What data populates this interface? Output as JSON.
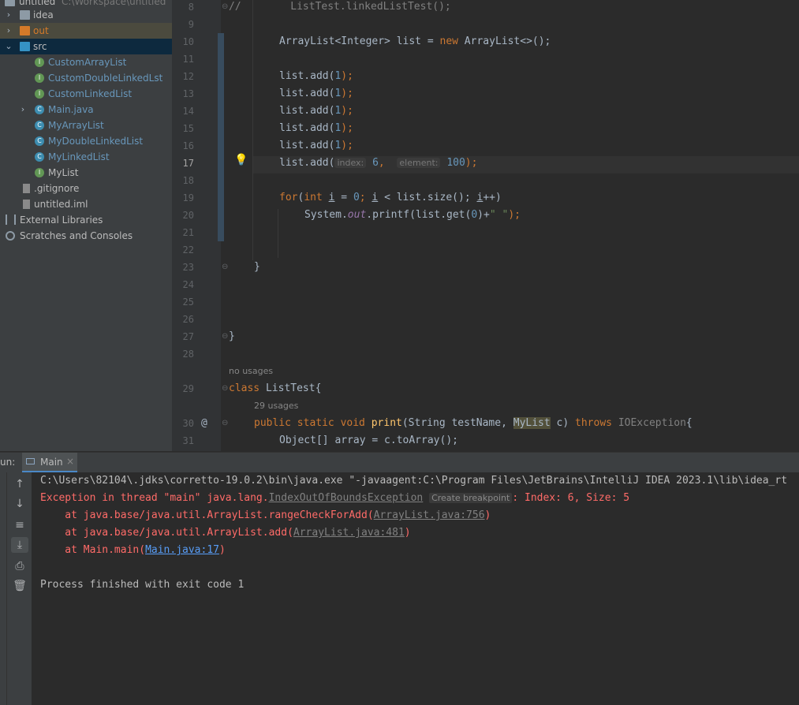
{
  "project": {
    "root_label": "untitled",
    "root_path": "C:\\Workspace\\untitled",
    "items": [
      {
        "label": "idea",
        "icon": "folder-icon"
      },
      {
        "label": "out",
        "icon": "folder-icon"
      },
      {
        "label": "src",
        "icon": "folder-icon"
      },
      {
        "label": "CustomArrayList",
        "icon": "interface-icon"
      },
      {
        "label": "CustomDoubleLinkedLst",
        "icon": "interface-icon"
      },
      {
        "label": "CustomLinkedList",
        "icon": "interface-icon"
      },
      {
        "label": "Main.java",
        "icon": "class-icon"
      },
      {
        "label": "MyArrayList",
        "icon": "class-icon"
      },
      {
        "label": "MyDoubleLinkedList",
        "icon": "class-icon"
      },
      {
        "label": "MyLinkedList",
        "icon": "class-icon"
      },
      {
        "label": "MyList",
        "icon": "interface-icon"
      },
      {
        "label": ".gitignore",
        "icon": "file-icon"
      },
      {
        "label": "untitled.iml",
        "icon": "file-icon"
      },
      {
        "label": "External Libraries",
        "icon": "library-icon"
      },
      {
        "label": "Scratches and Consoles",
        "icon": "scratch-icon"
      }
    ]
  },
  "editor": {
    "line_numbers": [
      "8",
      "9",
      "10",
      "11",
      "12",
      "13",
      "14",
      "15",
      "16",
      "17",
      "18",
      "19",
      "20",
      "21",
      "22",
      "23",
      "24",
      "25",
      "26",
      "27",
      "28",
      "29",
      "30",
      "31"
    ],
    "l8": "//        ListTest.linkedListTest();",
    "l10_type": "ArrayList<Integer> list = ",
    "l10_new": "new",
    "l10_rest": " ArrayList<>();",
    "add_prefix": "list.add(",
    "add_arg": "1",
    "add_suffix": ");",
    "l17_hint_index": "index:",
    "l17_index_val": "6",
    "l17_hint_element": "element:",
    "l17_element_val": "100",
    "l19_for": "for",
    "l19_int": "int",
    "l19_i": "i",
    "l19_rest1": " = ",
    "l19_zero": "0",
    "l19_semi": "; ",
    "l19_cond": " < list.size(); ",
    "l19_inc": "i",
    "l19_end": "++)",
    "l20_sys": "System.",
    "l20_out": "out",
    "l20_mid": ".printf(list.get(",
    "l20_zero": "0",
    "l20_plus": ")+",
    "l20_str": "\" \"",
    "l20_end": ");",
    "brace": "}",
    "no_usages": "no usages",
    "l29_class": "class",
    "l29_name": " ListTest{",
    "usages_29": "29 usages",
    "l30_at": "@",
    "l30_mods": "public static void",
    "l30_method": "print",
    "l30_args1": "(String testName, ",
    "l30_type": "MyList",
    "l30_args2": " c) ",
    "l30_throws": "throws",
    "l30_exc": " IOException",
    "l30_end": "{",
    "l31": "Object[] array = c.toArray();"
  },
  "run": {
    "prefix": "un:",
    "tab_label": "Main",
    "close_icon": "×",
    "cmd": "C:\\Users\\82104\\.jdks\\corretto-19.0.2\\bin\\java.exe \"-javaagent:C:\\Program Files\\JetBrains\\IntelliJ IDEA 2023.1\\lib\\idea_rt",
    "exc_prefix": "Exception in thread \"main\" java.lang.",
    "exc_class": "IndexOutOfBoundsException",
    "create_bp": "Create breakpoint",
    "exc_suffix": ": Index: 6, Size: 5",
    "trace1_pre": "    at java.base/java.util.ArrayList.rangeCheckForAdd(",
    "trace1_link": "ArrayList.java:756",
    "trace2_pre": "    at java.base/java.util.ArrayList.add(",
    "trace2_link": "ArrayList.java:481",
    "trace3_pre": "    at Main.main(",
    "trace3_link": "Main.java:17",
    "close_paren": ")",
    "exit": "Process finished with exit code 1"
  }
}
